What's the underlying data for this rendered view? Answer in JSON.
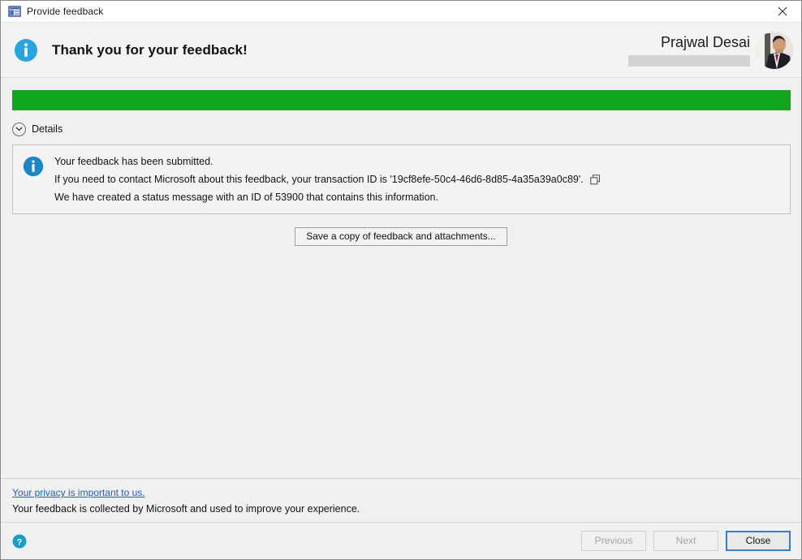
{
  "window": {
    "title": "Provide feedback",
    "icon": "feedback-window-icon",
    "close_label": "✕"
  },
  "header": {
    "icon": "info-circle-icon",
    "title": "Thank you for your feedback!",
    "user": {
      "name": "Prajwal Desai",
      "avatar": "user-avatar-photo",
      "redacted_field": ""
    }
  },
  "progress": {
    "percent": 100,
    "fill_color": "#10a41f",
    "track_color": "#e9e9e9"
  },
  "details_expander": {
    "label": "Details",
    "icon": "chevron-down-icon",
    "expanded": true
  },
  "details_panel": {
    "icon": "info-circle-icon",
    "lines": [
      "Your feedback has been submitted.",
      "If you need to contact Microsoft about this feedback, your transaction ID is '19cf8efe-50c4-46d6-8d85-4a35a39a0c89'.",
      "We have created a status message with an ID of 53900 that contains this information."
    ],
    "transaction_id": "19cf8efe-50c4-46d6-8d85-4a35a39a0c89",
    "status_message_id": "53900",
    "copy_icon": "copy-icon"
  },
  "actions": {
    "save_copy_label": "Save a copy of feedback and attachments..."
  },
  "privacy": {
    "link_text": "Your privacy is important to us.",
    "note": "Your feedback is collected by Microsoft and used to improve your experience.",
    "link_color": "#1b62b5"
  },
  "footer": {
    "help_icon": "help-circle-icon",
    "previous_label": "Previous",
    "next_label": "Next",
    "close_label": "Close",
    "previous_enabled": false,
    "next_enabled": false,
    "default_button": "Close"
  }
}
